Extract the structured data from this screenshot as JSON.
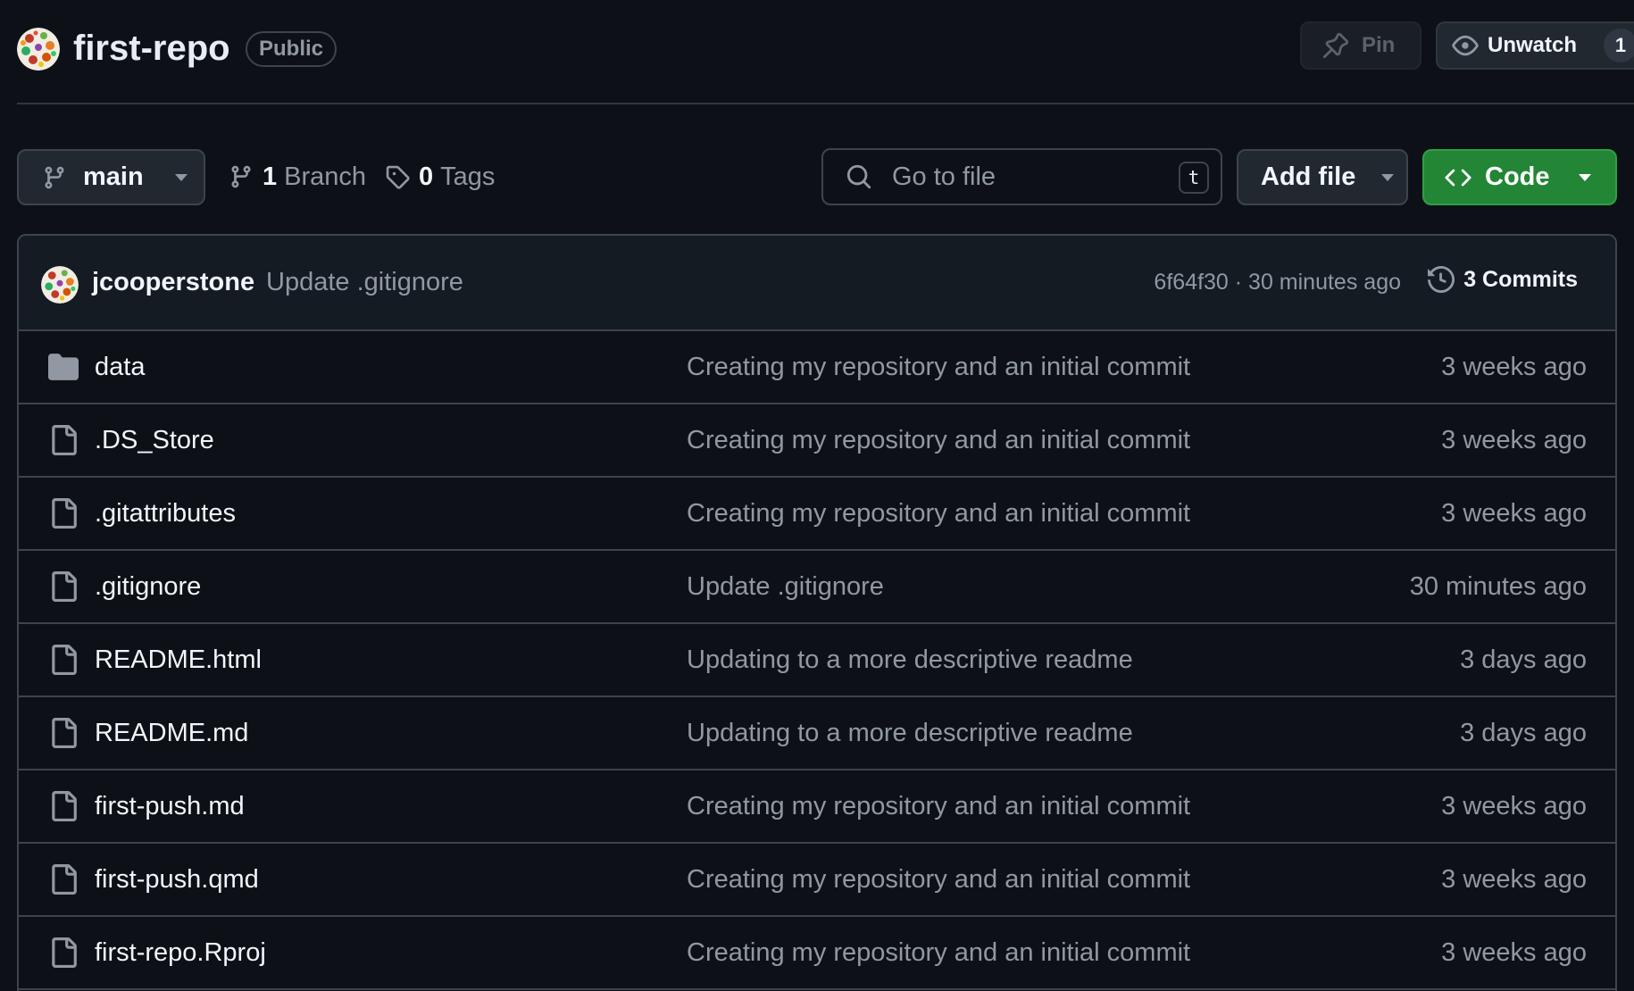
{
  "repo": {
    "name": "first-repo",
    "visibility": "Public",
    "pin_label": "Pin",
    "unwatch_label": "Unwatch",
    "watch_count": "1"
  },
  "toolbar": {
    "branch": "main",
    "branch_count": "1",
    "branch_label": "Branch",
    "tag_count": "0",
    "tag_label": "Tags",
    "search_placeholder": "Go to file",
    "search_shortcut": "t",
    "add_file_label": "Add file",
    "code_label": "Code"
  },
  "latest_commit": {
    "author": "jcooperstone",
    "message": "Update .gitignore",
    "meta": "6f64f30 · 30 minutes ago",
    "commits_label": "3 Commits"
  },
  "files": [
    {
      "name": "data",
      "type": "folder",
      "message": "Creating my repository and an initial commit",
      "age": "3 weeks ago"
    },
    {
      "name": ".DS_Store",
      "type": "file",
      "message": "Creating my repository and an initial commit",
      "age": "3 weeks ago"
    },
    {
      "name": ".gitattributes",
      "type": "file",
      "message": "Creating my repository and an initial commit",
      "age": "3 weeks ago"
    },
    {
      "name": ".gitignore",
      "type": "file",
      "message": "Update .gitignore",
      "age": "30 minutes ago"
    },
    {
      "name": "README.html",
      "type": "file",
      "message": "Updating to a more descriptive readme",
      "age": "3 days ago"
    },
    {
      "name": "README.md",
      "type": "file",
      "message": "Updating to a more descriptive readme",
      "age": "3 days ago"
    },
    {
      "name": "first-push.md",
      "type": "file",
      "message": "Creating my repository and an initial commit",
      "age": "3 weeks ago"
    },
    {
      "name": "first-push.qmd",
      "type": "file",
      "message": "Creating my repository and an initial commit",
      "age": "3 weeks ago"
    },
    {
      "name": "first-repo.Rproj",
      "type": "file",
      "message": "Creating my repository and an initial commit",
      "age": "3 weeks ago"
    }
  ],
  "colors": {
    "background": "#0d1117",
    "border": "#3d444d",
    "code_button": "#238636",
    "muted_text": "#9198a1"
  }
}
